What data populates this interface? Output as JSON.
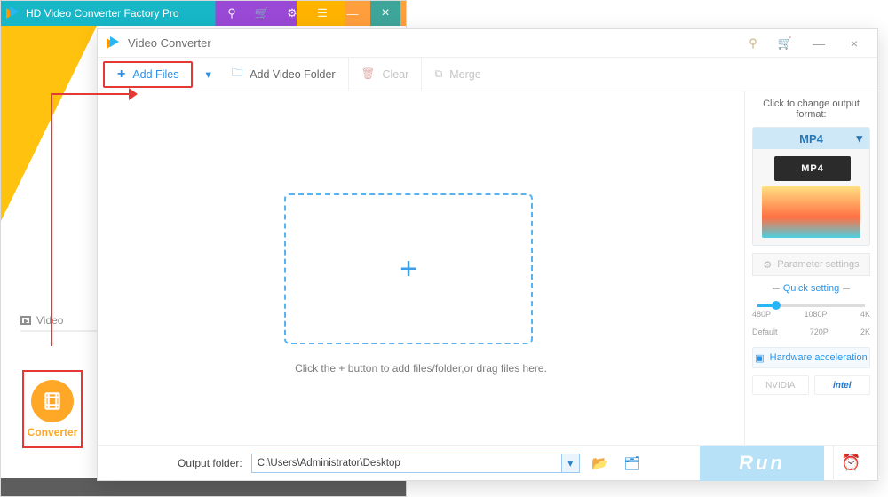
{
  "parent": {
    "title": "HD Video Converter Factory Pro",
    "sidebar_video": "Video",
    "converter_label": "Converter"
  },
  "child": {
    "title": "Video Converter",
    "toolbar": {
      "add_files": "Add Files",
      "add_folder": "Add Video Folder",
      "clear": "Clear",
      "merge": "Merge"
    },
    "drop_hint": "Click the + button to add files/folder,or drag files here.",
    "side": {
      "change_hint": "Click to change output format:",
      "format_label": "MP4",
      "format_badge": "MP4",
      "param": "Parameter settings",
      "quick": "Quick setting",
      "ticks_top": [
        "480P",
        "1080P",
        "4K"
      ],
      "ticks_bottom": [
        "Default",
        "720P",
        "2K"
      ],
      "hw": "Hardware acceleration",
      "nvidia": "NVIDIA",
      "intel": "intel"
    },
    "output": {
      "label": "Output folder:",
      "path": "C:\\Users\\Administrator\\Desktop",
      "run": "Run"
    }
  }
}
